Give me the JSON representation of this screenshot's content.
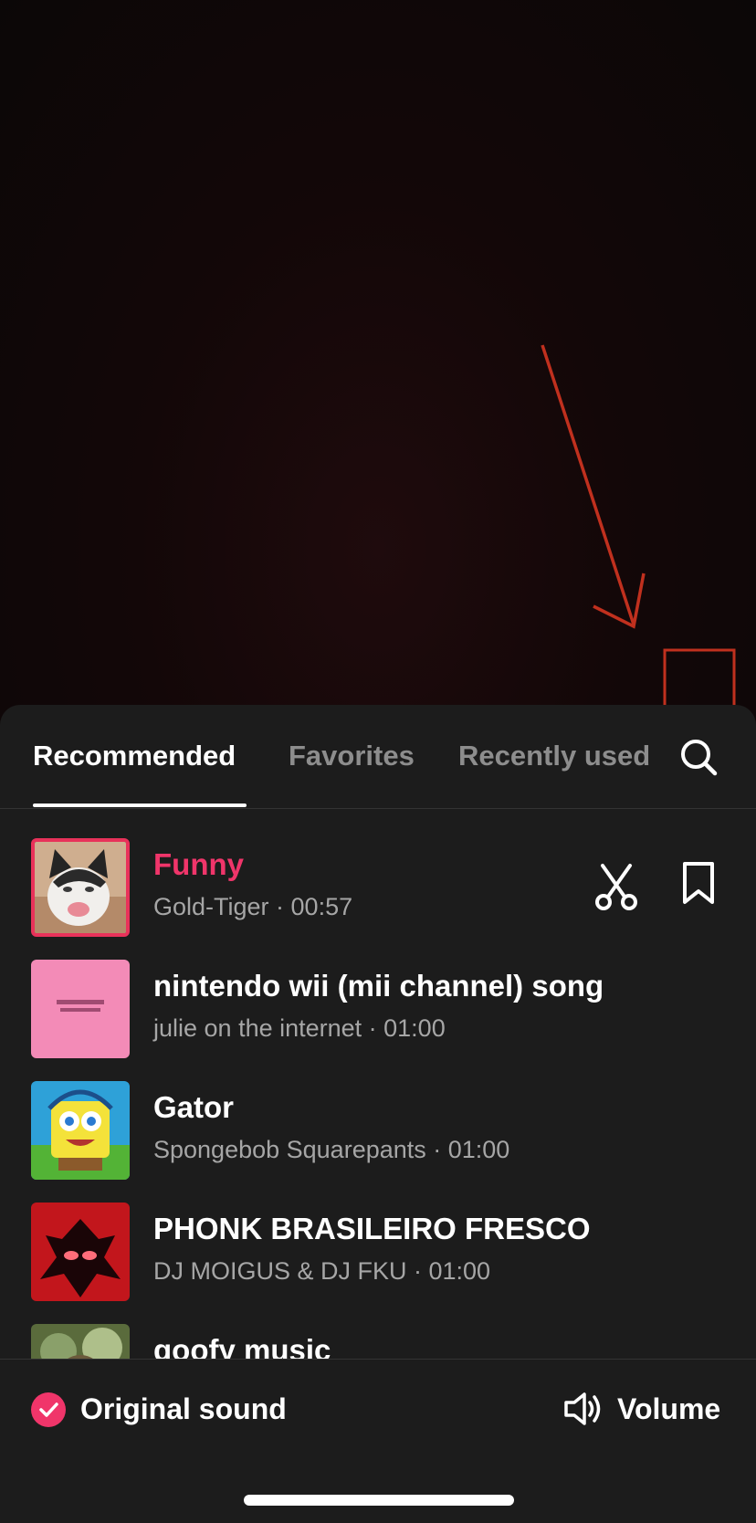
{
  "tabs": [
    {
      "label": "Recommended",
      "active": true
    },
    {
      "label": "Favorites",
      "active": false
    },
    {
      "label": "Recently used",
      "active": false
    }
  ],
  "tracks": [
    {
      "title": "Funny",
      "subtitle": "Gold-Tiger · 00:57",
      "selected": true,
      "thumb": "cat-photo"
    },
    {
      "title": "nintendo wii (mii channel) song",
      "subtitle": "julie on the internet · 01:00",
      "thumb": "pink-cover"
    },
    {
      "title": "Gator",
      "subtitle": "Spongebob Squarepants · 01:00",
      "thumb": "spongebob"
    },
    {
      "title": "PHONK BRASILEIRO FRESCO",
      "subtitle": "DJ MOIGUS & DJ FKU · 01:00",
      "thumb": "red-shadow"
    },
    {
      "title": "goofy music",
      "thumb": "forest"
    }
  ],
  "bottom": {
    "original_sound": "Original sound",
    "volume": "Volume"
  },
  "icons": {
    "search": "search-icon",
    "trim": "scissors-icon",
    "favorite": "bookmark-icon",
    "volume": "speaker-icon",
    "check": "check-icon"
  },
  "colors": {
    "accent": "#f0356a",
    "sheet": "#1c1c1c",
    "annotation": "#c0301e"
  }
}
